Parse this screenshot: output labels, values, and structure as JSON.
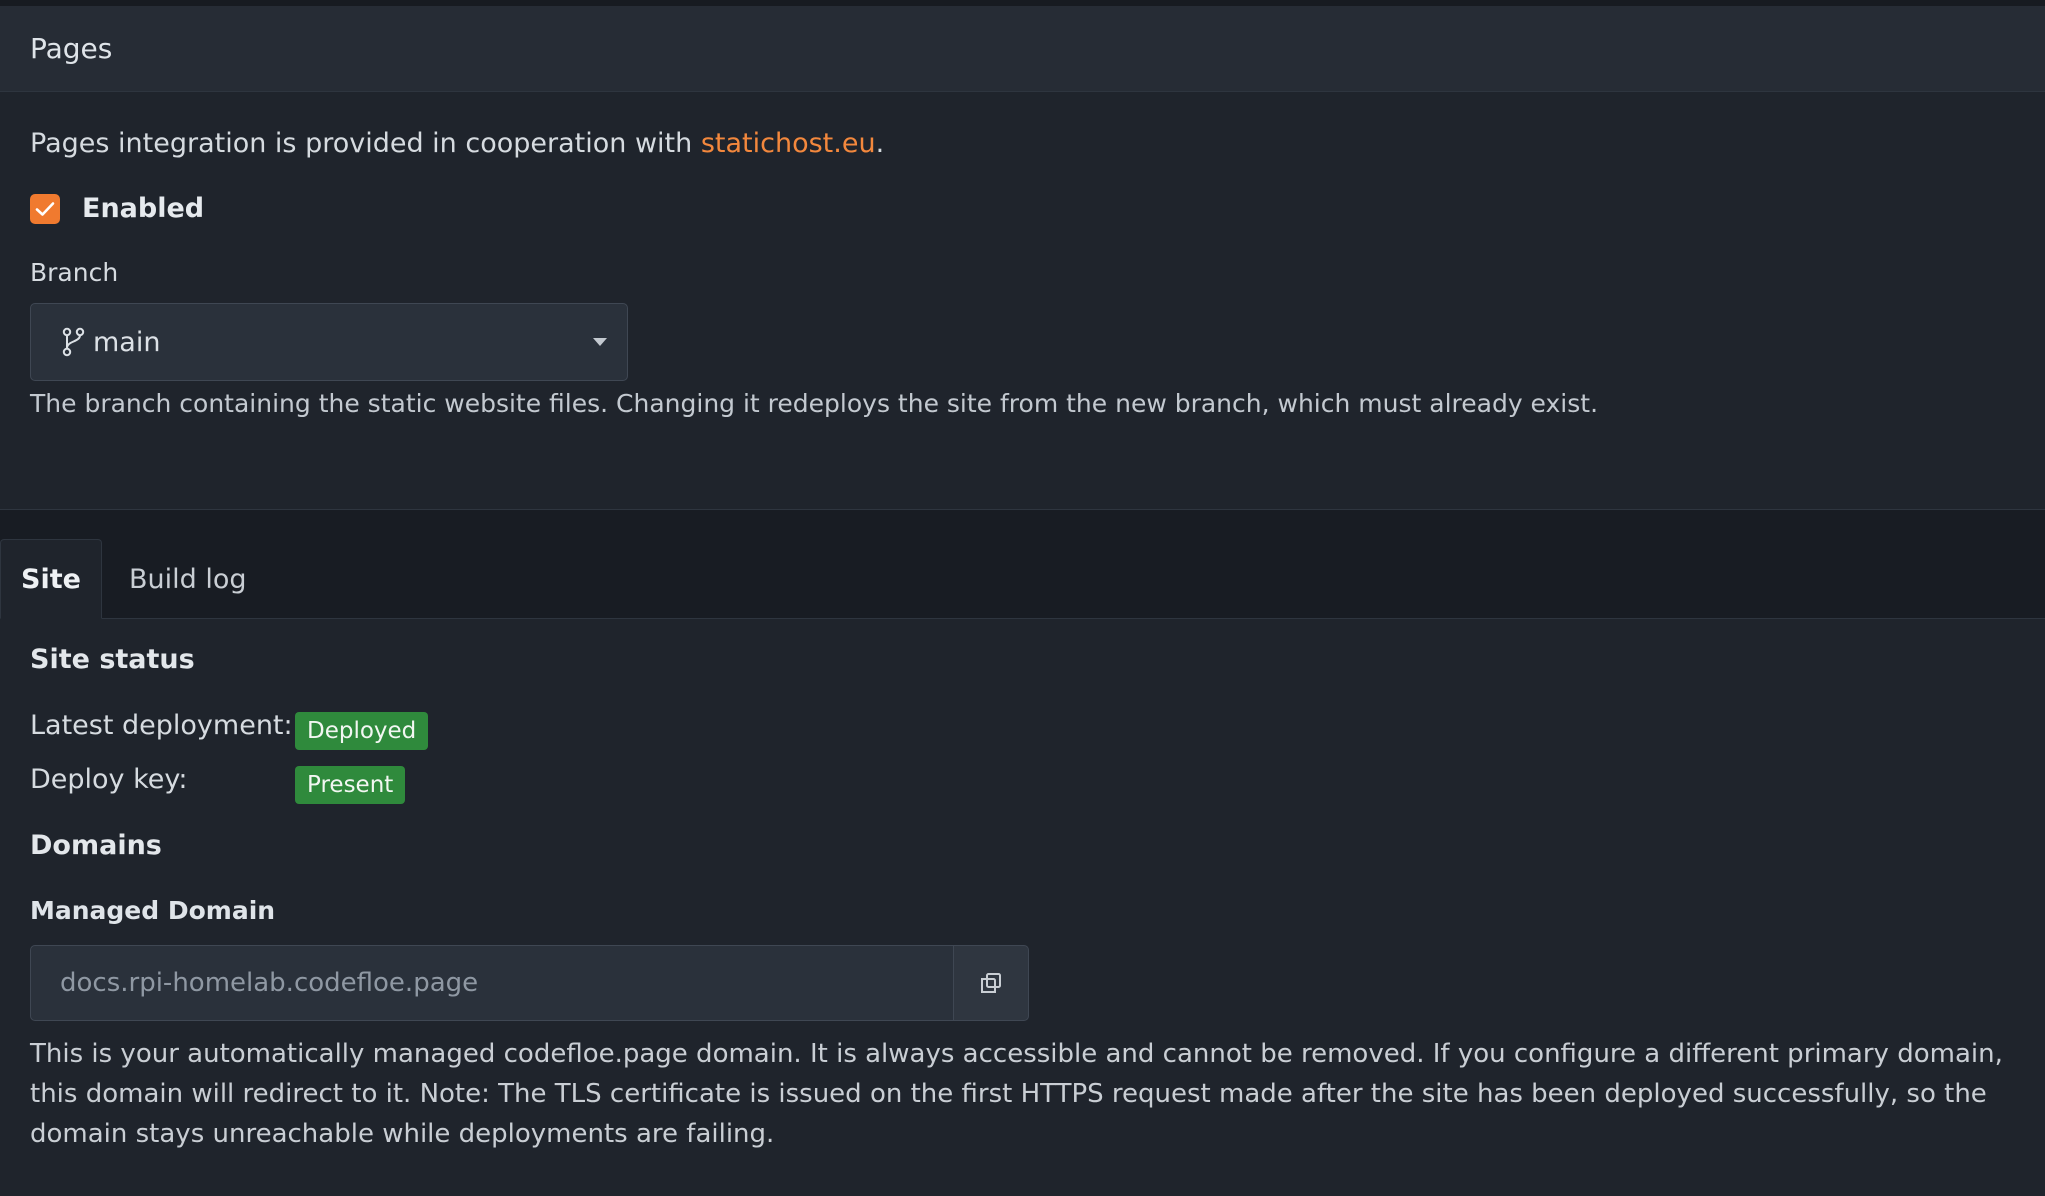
{
  "section": {
    "title": "Pages"
  },
  "intro": {
    "text": "Pages integration is provided in cooperation with ",
    "link_text": "statichost.eu",
    "suffix": "."
  },
  "enabled_checkbox": {
    "label": "Enabled",
    "checked": true
  },
  "branch": {
    "label": "Branch",
    "selected": "main",
    "help": "The branch containing the static website files. Changing it redeploys the site from the new branch, which must already exist."
  },
  "tabs": [
    {
      "label": "Site",
      "active": true
    },
    {
      "label": "Build log",
      "active": false
    }
  ],
  "site_status": {
    "heading": "Site status",
    "latest_deployment_label": "Latest deployment:",
    "latest_deployment_value": "Deployed",
    "deploy_key_label": "Deploy key:",
    "deploy_key_value": "Present"
  },
  "domains": {
    "heading": "Domains",
    "managed_label": "Managed Domain",
    "managed_value": "docs.rpi-homelab.codefloe.page",
    "help": "This is your automatically managed codefloe.page domain. It is always accessible and cannot be removed. If you configure a different primary domain, this domain will redirect to it. Note: The TLS certificate is issued on the first HTTPS request made after the site has been deployed successfully, so the domain stays unreachable while deployments are failing."
  },
  "colors": {
    "accent": "#f07a2f",
    "link": "#f3883d",
    "success": "#2f8a3c",
    "background": "#1f242c"
  }
}
